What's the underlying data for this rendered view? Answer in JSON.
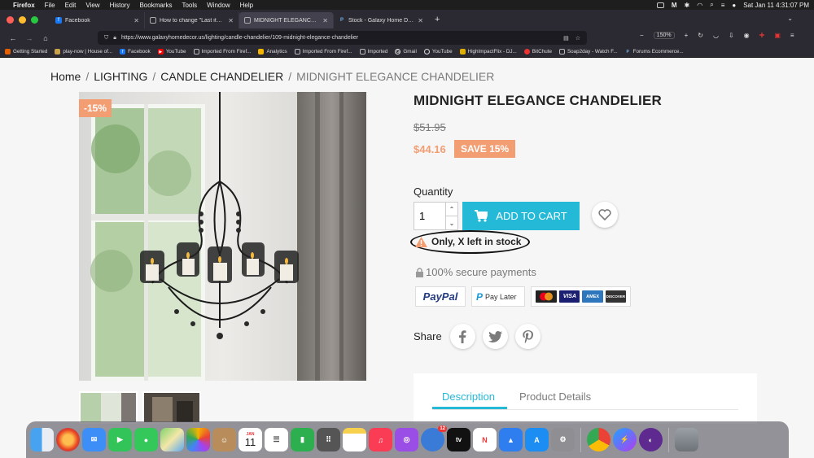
{
  "menubar": {
    "app": "Firefox",
    "items": [
      "File",
      "Edit",
      "View",
      "History",
      "Bookmarks",
      "Tools",
      "Window",
      "Help"
    ],
    "clock": "Sat Jan 11  4:31:07 PM"
  },
  "browser": {
    "tabs": [
      {
        "title": "Facebook",
        "favicon_color": "#1877f2",
        "favicon": "f"
      },
      {
        "title": "How to change \"Last items in st",
        "favicon_color": "#555555",
        "favicon": "▢"
      },
      {
        "title": "MIDNIGHT ELEGANCE CHANDE",
        "favicon_color": "#888888",
        "favicon": "▢"
      },
      {
        "title": "Stock - Galaxy Home Decor & G",
        "favicon_color": "#0a6ebd",
        "favicon": "P"
      }
    ],
    "url": "https://www.galaxyhomedecor.us/lighting/candle-chandelier/109-midnight-elegance-chandelier",
    "zoom": "150%",
    "bookmarks": [
      {
        "label": "Getting Started",
        "color": "#e66000"
      },
      {
        "label": "play-now | House of...",
        "color": "#c9a34a"
      },
      {
        "label": "Facebook",
        "color": "#1877f2"
      },
      {
        "label": "YouTube",
        "color": "#ff0000"
      },
      {
        "label": "Imported From Firef...",
        "color": "#777777"
      },
      {
        "label": "Analytics",
        "color": "#f4b400"
      },
      {
        "label": "Imported From Firef...",
        "color": "#777777"
      },
      {
        "label": "Imported",
        "color": "#777777"
      },
      {
        "label": "Gmail",
        "color": "#dddddd"
      },
      {
        "label": "YouTube",
        "color": "#dddddd"
      },
      {
        "label": "HighImpactFlix - DJ...",
        "color": "#e0b000"
      },
      {
        "label": "BitChute",
        "color": "#ee3333"
      },
      {
        "label": "Soap2day - Watch F...",
        "color": "#dddddd"
      },
      {
        "label": "Forums Ecommerce...",
        "color": "#0a6ebd"
      }
    ]
  },
  "breadcrumb": {
    "home": "Home",
    "lighting": "LIGHTING",
    "category": "CANDLE CHANDELIER",
    "current": "MIDNIGHT ELEGANCE CHANDELIER"
  },
  "product": {
    "discount_flag": "-15%",
    "title": "MIDNIGHT ELEGANCE CHANDELIER",
    "old_price": "$51.95",
    "new_price": "$44.16",
    "save_label": "SAVE 15%",
    "quantity_label": "Quantity",
    "quantity_value": "1",
    "add_to_cart": "ADD TO CART",
    "stock_message": "Only, X left in stock",
    "secure_payments": "100% secure payments",
    "payments": {
      "paypal": "PayPal",
      "paylater": "Pay Later",
      "visa": "VISA",
      "amex": "AMEX",
      "discover": "DISCOVER",
      "mastercard": "mastercard"
    },
    "share_label": "Share"
  },
  "product_tabs": {
    "description": "Description",
    "details": "Product Details"
  },
  "dock": {
    "calendar_month": "JAN",
    "calendar_day": "11",
    "badge_count": "12",
    "appletv": "tv"
  }
}
